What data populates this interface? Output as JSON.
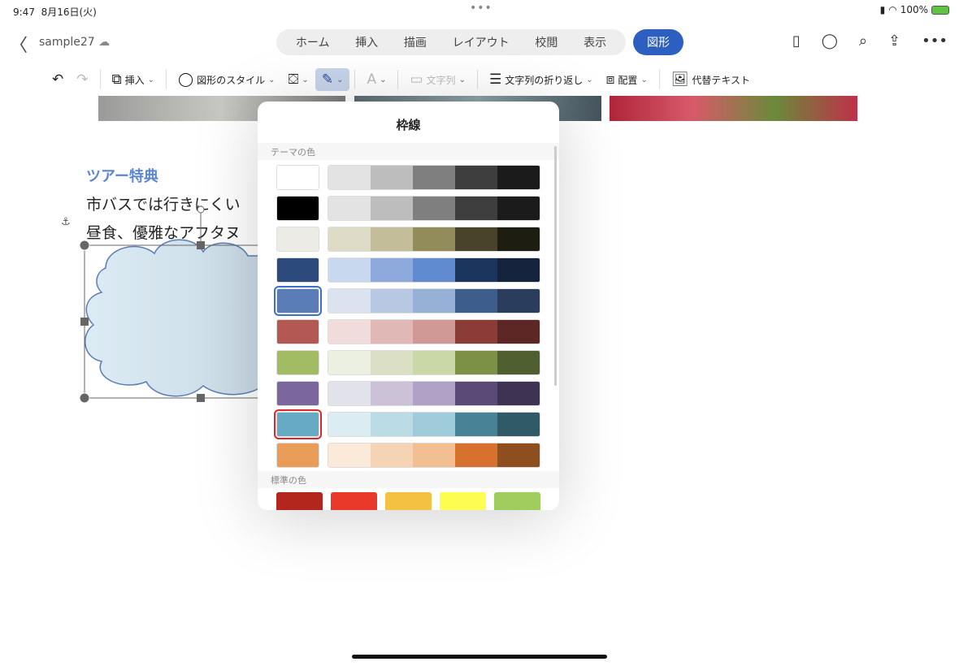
{
  "status": {
    "time": "9:47",
    "date": "8月16日(火)",
    "battery": "100%"
  },
  "title": {
    "doc_name": "sample27",
    "tabs": [
      "ホーム",
      "挿入",
      "描画",
      "レイアウト",
      "校閲",
      "表示"
    ],
    "active_tab": "図形"
  },
  "toolbar": {
    "insert": "挿入",
    "shape_style": "図形のスタイル",
    "text": "文字列",
    "wrap": "文字列の折り返し",
    "arrange": "配置",
    "alt_text": "代替テキスト"
  },
  "document": {
    "heading": "ツアー特典",
    "line1": "市バスでは行きにくい",
    "line2": "昼食、優雅なアフタヌ"
  },
  "popover": {
    "title": "枠線",
    "theme_label": "テーマの色",
    "standard_label": "標準の色",
    "theme_colors": [
      {
        "base": "#ffffff",
        "shades": [
          "#e3e3e3",
          "#bdbdbd",
          "#7f7f7f",
          "#3e3e3e",
          "#1b1b1b"
        ]
      },
      {
        "base": "#000000",
        "shades": [
          "#e3e3e3",
          "#bdbdbd",
          "#7f7f7f",
          "#3e3e3e",
          "#1b1b1b"
        ]
      },
      {
        "base": "#ecebe5",
        "shades": [
          "#dedcc6",
          "#c4bd99",
          "#928c5a",
          "#4a432b",
          "#1e1d12"
        ]
      },
      {
        "base": "#2c4a7c",
        "shades": [
          "#c8d8ef",
          "#8eaadc",
          "#618bd0",
          "#1c355c",
          "#14223c"
        ]
      },
      {
        "base": "#5a7db8",
        "shades": [
          "#dce3f0",
          "#b8c8e3",
          "#97b1d6",
          "#3d5d8d",
          "#2a3d5c"
        ],
        "selected": "blue"
      },
      {
        "base": "#b45853",
        "shades": [
          "#f0dcdb",
          "#e0b9b7",
          "#d09996",
          "#8b3c37",
          "#5c2724"
        ]
      },
      {
        "base": "#a2bc64",
        "shades": [
          "#ecf0e1",
          "#dadfc6",
          "#c9d8a6",
          "#7c9146",
          "#505f2f"
        ]
      },
      {
        "base": "#7b669e",
        "shades": [
          "#e2e2ea",
          "#cbc2d8",
          "#b0a1c6",
          "#5b4a78",
          "#3e3352"
        ]
      },
      {
        "base": "#67aac4",
        "shades": [
          "#dcecf3",
          "#bbdce5",
          "#9fcbdb",
          "#478296",
          "#305a67"
        ],
        "selected": "red"
      },
      {
        "base": "#e99d59",
        "shades": [
          "#fbe9da",
          "#f5d3b5",
          "#f1bf91",
          "#d7712e",
          "#8e4e1d"
        ]
      }
    ],
    "standard_colors": [
      "#b3261e",
      "#e8392b",
      "#f5c142",
      "#fdfd51",
      "#9fce5e"
    ]
  },
  "accent": "#2c5fbf"
}
